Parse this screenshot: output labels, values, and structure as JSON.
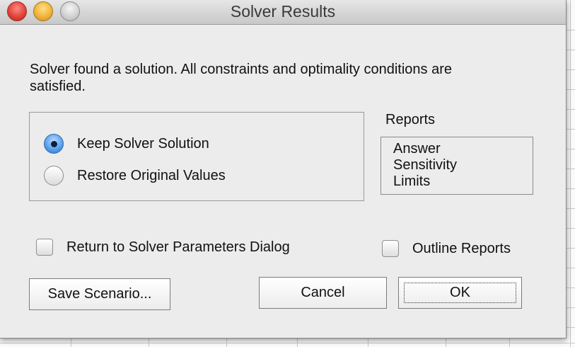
{
  "window": {
    "title": "Solver Results"
  },
  "message": "Solver found a solution.  All constraints and optimality conditions are satisfied.",
  "options": {
    "keep_label": "Keep Solver Solution",
    "restore_label": "Restore Original Values",
    "selected": "keep"
  },
  "reports": {
    "label": "Reports",
    "items": [
      "Answer",
      "Sensitivity",
      "Limits"
    ]
  },
  "checks": {
    "return_label": "Return to Solver Parameters Dialog",
    "return_checked": false,
    "outline_label": "Outline Reports",
    "outline_checked": false
  },
  "buttons": {
    "save_label": "Save Scenario...",
    "cancel_label": "Cancel",
    "ok_label": "OK"
  },
  "colors": {
    "close": "#e0443a",
    "minimize": "#f0b43a",
    "zoom_disabled": "#cfcfcf",
    "radio_selected": "#5aa2ec"
  }
}
